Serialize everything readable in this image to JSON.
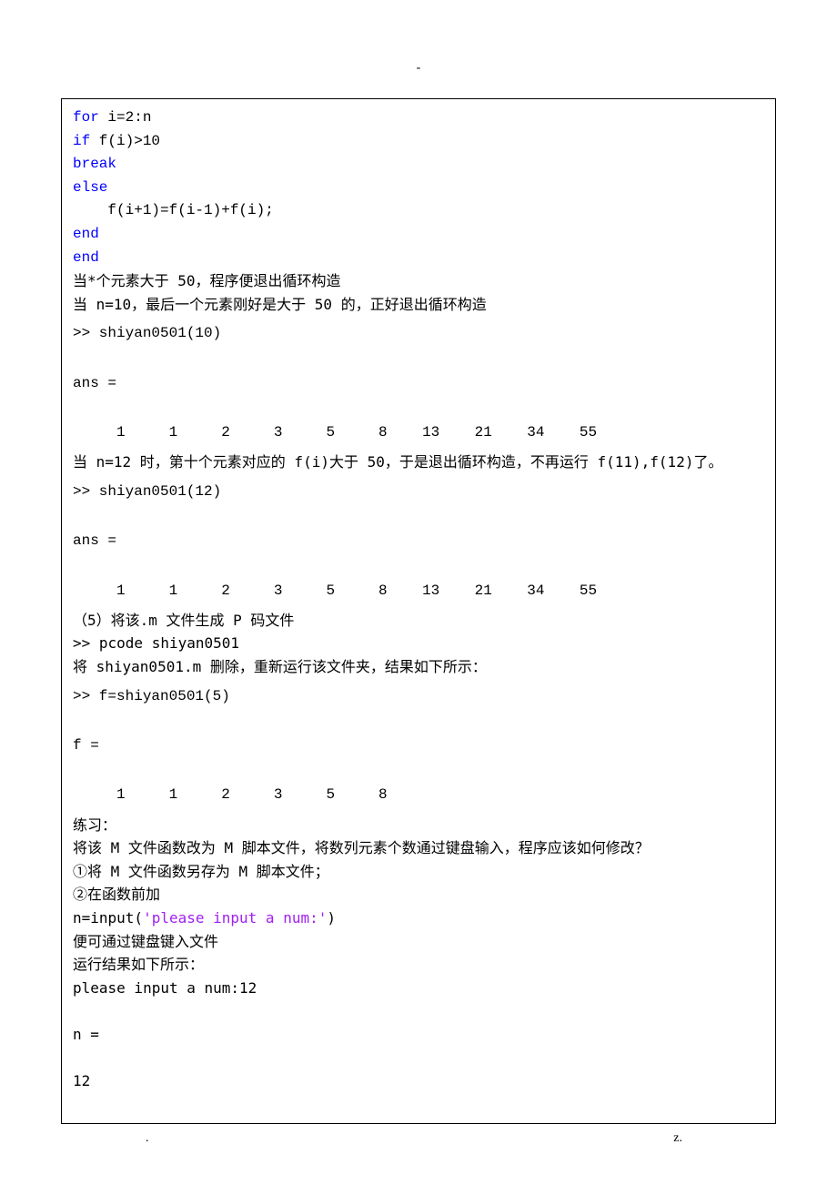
{
  "markers": {
    "top": "-",
    "footer_left": ".",
    "footer_right": "z."
  },
  "code": {
    "l1_kw": "for",
    "l1_rest": " i=2:n",
    "l2_kw": "if",
    "l2_rest": " f(i)>10",
    "l3": "break",
    "l4": "else",
    "l5": "    f(i+1)=f(i-1)+f(i);",
    "l6": "end",
    "l7": "end"
  },
  "text": {
    "t1": "当*个元素大于 50，程序便退出循环构造",
    "t2": "当 n=10，最后一个元素刚好是大于 50 的，正好退出循环构造",
    "t3": "当 n=12 时，第十个元素对应的 f(i)大于 50，于是退出循环构造，不再运行 f(11),f(12)了。",
    "t4": "（5）将该.m 文件生成 P 码文件",
    "t5": ">> pcode shiyan0501",
    "t6": "将 shiyan0501.m 删除，重新运行该文件夹，结果如下所示：",
    "t7": "练习：",
    "t8": "将该 M 文件函数改为 M 脚本文件，将数列元素个数通过键盘输入，程序应该如何修改？",
    "t9": "①将 M 文件函数另存为 M 脚本文件；",
    "t10": "②在函数前加",
    "t11a": "n=input(",
    "t11b": "'please input a num:'",
    "t11c": ")",
    "t12": "便可通过键盘键入文件",
    "t13": "运行结果如下所示：",
    "t14": "please input a num:12",
    "t15": "n =",
    "t16": "    12"
  },
  "matlab": {
    "out1": ">> shiyan0501(10)\n\nans =\n\n     1     1     2     3     5     8    13    21    34    55",
    "out2": ">> shiyan0501(12)\n\nans =\n\n     1     1     2     3     5     8    13    21    34    55",
    "out3": ">> f=shiyan0501(5)\n\nf =\n\n     1     1     2     3     5     8"
  }
}
